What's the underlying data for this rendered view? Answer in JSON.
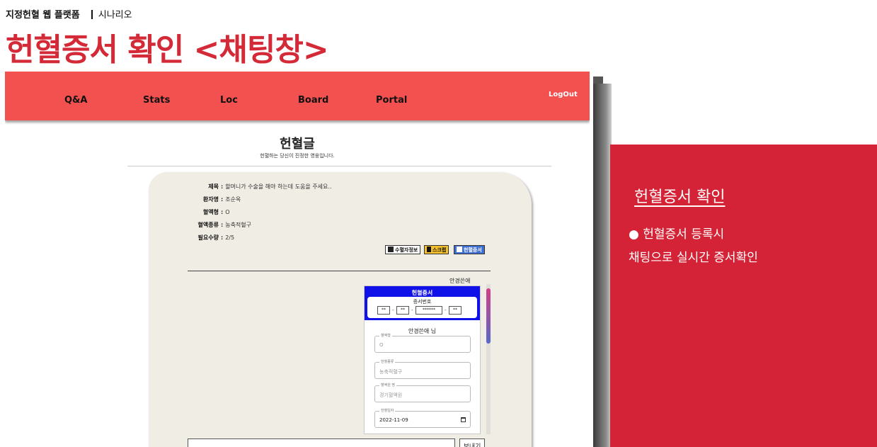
{
  "header": {
    "breadcrumb_main": "지정헌혈 웹 플랫폼",
    "breadcrumb_sub": "시나리오",
    "title": "헌혈증서 확인 <채팅창>"
  },
  "site": {
    "nav": [
      "Q&A",
      "Stats",
      "Loc",
      "Board",
      "Portal"
    ],
    "logout": "LogOut",
    "nav_color": "#f25150",
    "board_title": "헌혈글",
    "board_subtitle": "헌혈하는 당신이 진정한 영웅입니다.",
    "post": {
      "fields": [
        {
          "label": "제목",
          "value": "할머니가 수술을 해야 하는데 도움을 주세요.."
        },
        {
          "label": "환자명",
          "value": "조순옥"
        },
        {
          "label": "혈액형",
          "value": "O"
        },
        {
          "label": "혈액종류",
          "value": "농축적혈구"
        },
        {
          "label": "필요수량",
          "value": "2/5"
        }
      ],
      "buttons": [
        {
          "label": "수혈자정보",
          "icon": "person-card-icon",
          "color": "#ffffff"
        },
        {
          "label": "스크랩",
          "icon": "bookmark-icon",
          "color": "#f5c02c"
        },
        {
          "label": "헌혈증서",
          "icon": "certificate-icon",
          "color": "#3f6fd2"
        }
      ]
    },
    "chat": {
      "sender": "안경쓴애",
      "certificate": {
        "title": "헌혈증서",
        "number_label": "증서번호",
        "number_segments": [
          "**",
          "**",
          "******",
          "**"
        ],
        "holder": "안경쓴애 님",
        "fields": [
          {
            "legend": "혈액형",
            "value": "O"
          },
          {
            "legend": "헌혈종류",
            "value": "농축적혈구"
          },
          {
            "legend": "혈액원 명",
            "value": "경기혈액원"
          },
          {
            "legend": "헌혈일자",
            "value": "2022-11-09"
          }
        ]
      },
      "send_button": "보내기"
    }
  },
  "panel": {
    "title": "헌혈증서 확인",
    "line1": "● 헌혈증서 등록시",
    "line2": "채팅으로 실시간 증서확인",
    "color": "#d42336"
  }
}
